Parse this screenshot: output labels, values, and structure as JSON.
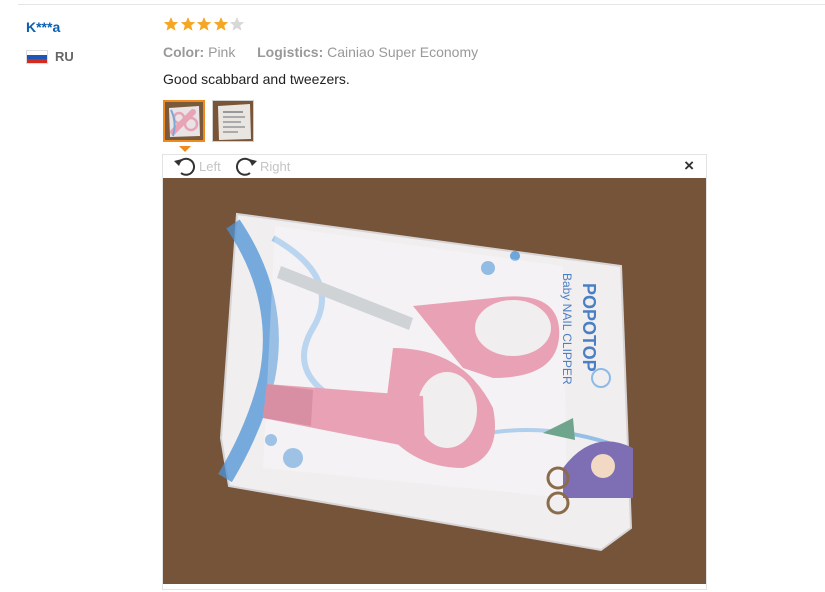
{
  "reviewer": {
    "name": "K***a",
    "country_code": "RU",
    "flag_colors": [
      "#ffffff",
      "#1c57b5",
      "#d52b1e"
    ]
  },
  "review": {
    "rating": 4,
    "max_rating": 5,
    "star_color": "#f5a623",
    "star_empty_color": "#d8d8d8",
    "color_label": "Color:",
    "color_value": "Pink",
    "logistics_label": "Logistics:",
    "logistics_value": "Cainiao Super Economy",
    "text": "Good scabbard and tweezers."
  },
  "photos": {
    "thumbnails": [
      {
        "name": "photo-thumbnail-1",
        "active": true
      },
      {
        "name": "photo-thumbnail-2",
        "active": false
      }
    ],
    "accent_color": "#f08a1c"
  },
  "viewer": {
    "rotate_left_label": "Left",
    "rotate_right_label": "Right",
    "close_label": "×",
    "photo_package_text": "POPOTOP",
    "photo_package_subtext": "Baby NAIL CLIPPER"
  }
}
